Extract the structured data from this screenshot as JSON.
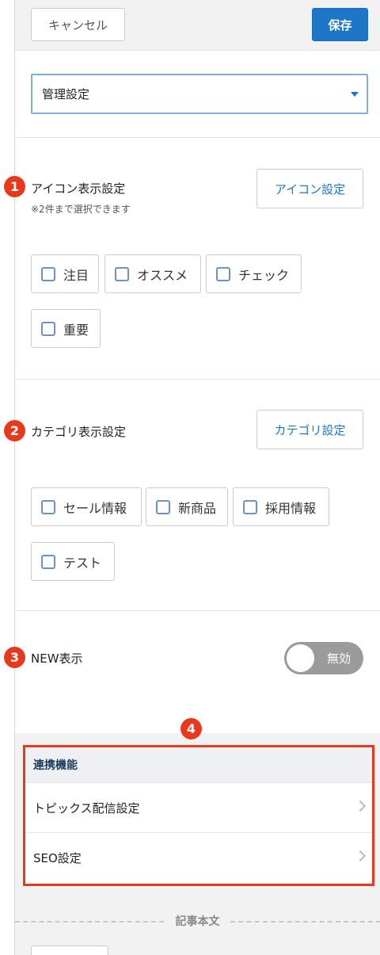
{
  "header": {
    "cancel_label": "キャンセル",
    "save_label": "保存"
  },
  "select": {
    "value": "管理設定"
  },
  "icon_settings": {
    "marker": "1",
    "title": "アイコン表示設定",
    "note": "※2件まで選択できます",
    "button_label": "アイコン設定",
    "options": [
      "注目",
      "オススメ",
      "チェック",
      "重要"
    ]
  },
  "category_settings": {
    "marker": "2",
    "title": "カテゴリ表示設定",
    "button_label": "カテゴリ設定",
    "options": [
      "セール情報",
      "新商品",
      "採用情報",
      "テスト"
    ]
  },
  "new_display": {
    "marker": "3",
    "title": "NEW表示",
    "toggle_label": "無効",
    "enabled": false
  },
  "linked": {
    "marker": "4",
    "header": "連携機能",
    "items": [
      "トピックス配信設定",
      "SEO設定"
    ]
  },
  "article_body": {
    "label": "記事本文"
  },
  "colors": {
    "accent": "#1d76c8",
    "marker": "#e8391c",
    "toggle_off": "#9b9b9b"
  }
}
